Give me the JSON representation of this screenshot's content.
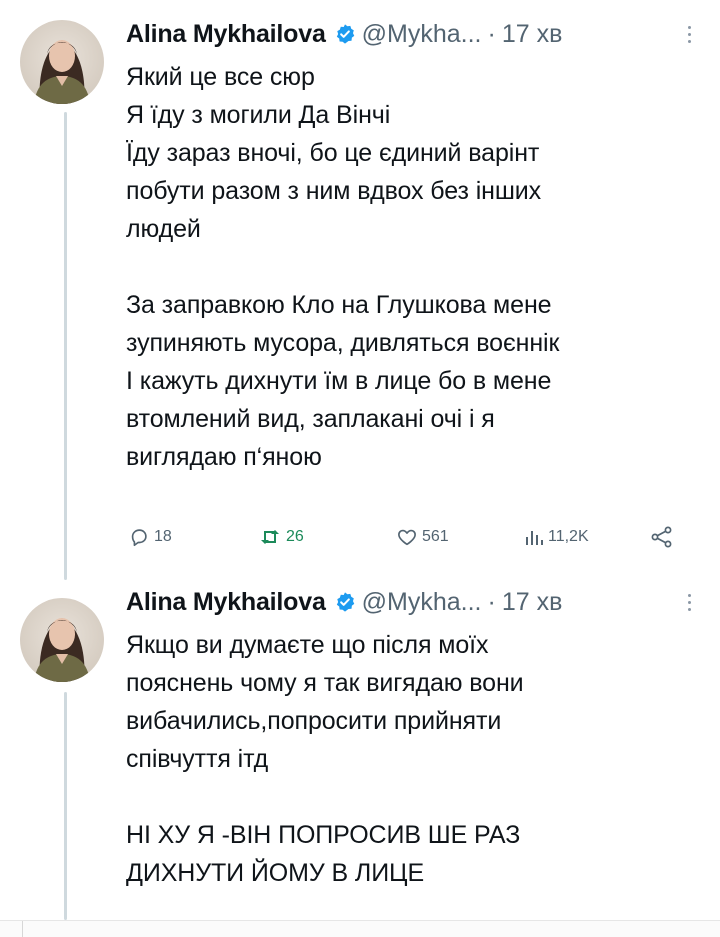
{
  "tweets": [
    {
      "author_name": "Alina Mykhailova",
      "handle": "@Mykha...",
      "dot": "·",
      "time": "17 хв",
      "lines": [
        "Який це все сюр",
        "Я їду з могили Да Вінчі",
        "Їду зараз вночі, бо це єдиний варінт",
        "побути разом з ним вдвох без інших",
        "людей",
        "",
        "За заправкою Кло на Глушкова мене",
        "зупиняють мусора, дивляться воєннік",
        "І кажуть дихнути їм в лице бо в мене",
        "втомлений вид, заплакані очі і я",
        "виглядаю п‘яною"
      ],
      "actions": {
        "replies": "18",
        "retweets": "26",
        "likes": "561",
        "views": "11,2K"
      }
    },
    {
      "author_name": "Alina Mykhailova",
      "handle": "@Mykha...",
      "dot": "·",
      "time": "17 хв",
      "lines": [
        "Якщо ви думаєте що після моїх",
        "пояснень чому я так вигядаю вони",
        "вибачились,попросити прийняти",
        "співчуття ітд",
        "",
        "НІ ХУ Я -ВІН ПОПРОСИВ ШЕ РАЗ",
        "ДИХНУТИ ЙОМУ В ЛИЦЕ"
      ]
    }
  ],
  "colors": {
    "verified_badge": "#1d9bf0",
    "retweet_green": "#1c8a5a",
    "muted_text": "#536471",
    "thread_line": "#cfd9de"
  },
  "icons": [
    "verified-badge-icon",
    "more-icon",
    "reply-icon",
    "retweet-icon",
    "like-icon",
    "views-icon",
    "share-icon"
  ]
}
